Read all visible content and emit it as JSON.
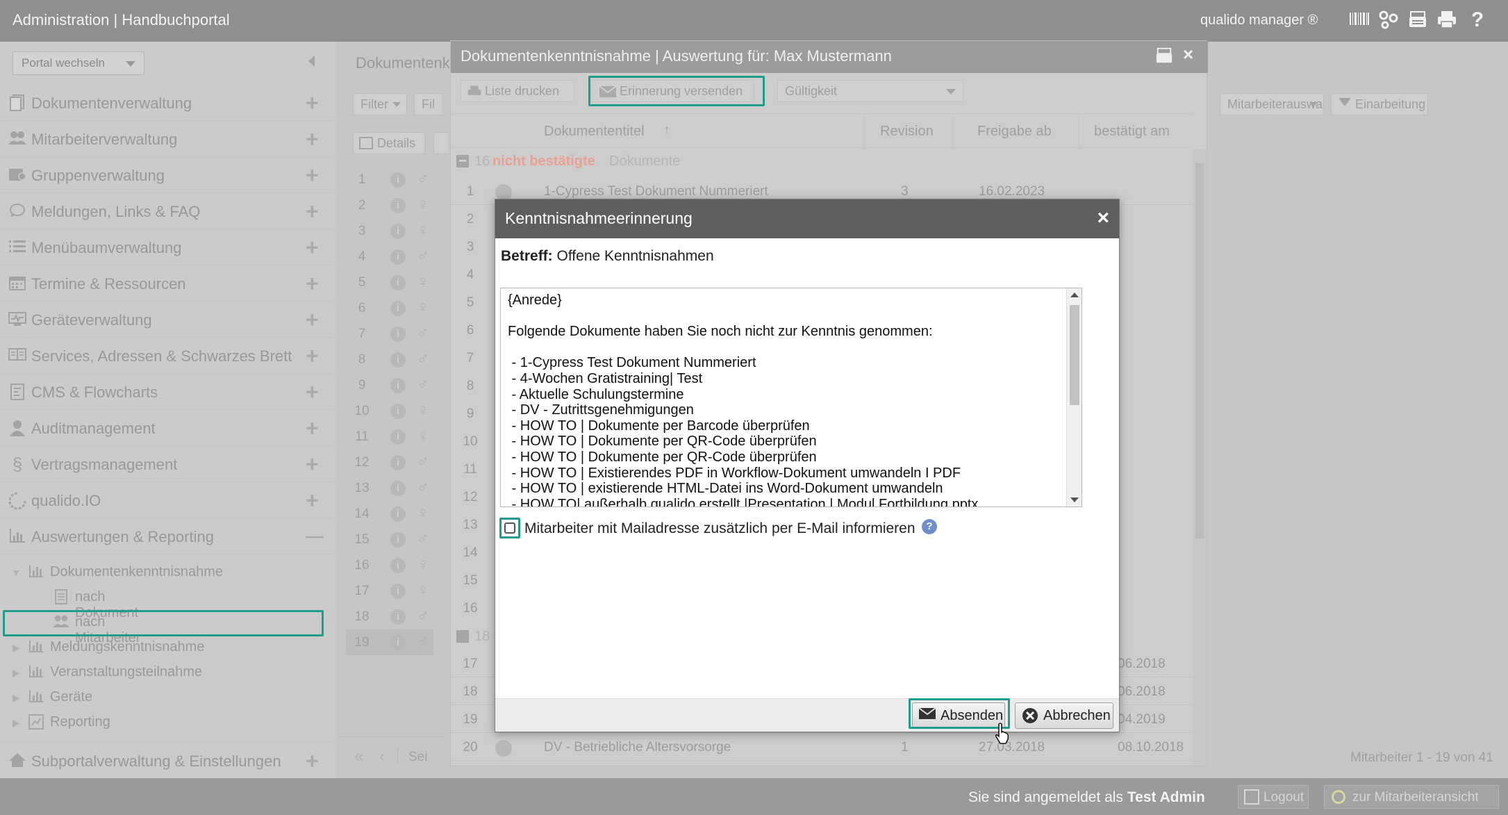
{
  "topbar": {
    "title": "Administration | Handbuchportal",
    "brand": "qualido manager ®",
    "icons": [
      "barcode-icon",
      "sitemap-icon",
      "fax-icon",
      "print-icon",
      "help-icon"
    ]
  },
  "sidebar": {
    "portal_select": "Portal wechseln",
    "items": [
      {
        "label": "Dokumentenverwaltung",
        "icon": "documents-icon"
      },
      {
        "label": "Mitarbeiterverwaltung",
        "icon": "users-icon"
      },
      {
        "label": "Gruppenverwaltung",
        "icon": "group-icon"
      },
      {
        "label": "Meldungen, Links & FAQ",
        "icon": "chat-icon"
      },
      {
        "label": "Menübaumverwaltung",
        "icon": "list-icon"
      },
      {
        "label": "Termine & Ressourcen",
        "icon": "calendar-icon"
      },
      {
        "label": "Geräteverwaltung",
        "icon": "device-icon"
      },
      {
        "label": "Services, Adressen & Schwarzes Brett",
        "icon": "address-book-icon"
      },
      {
        "label": "CMS & Flowcharts",
        "icon": "cms-icon"
      },
      {
        "label": "Auditmanagement",
        "icon": "auditor-icon"
      },
      {
        "label": "Vertragsmanagement",
        "icon": "paragraph-icon"
      },
      {
        "label": "qualido.IO",
        "icon": "io-icon"
      },
      {
        "label": "Auswertungen & Reporting",
        "icon": "chart-icon"
      }
    ],
    "subtree": {
      "parent": "Dokumentenkenntnisnahme",
      "children": [
        "nach Dokument",
        "nach Mitarbeiter"
      ],
      "siblings": [
        "Meldungskenntnisnahme",
        "Veranstaltungsteilnahme",
        "Geräte",
        "Reporting"
      ]
    },
    "footer_item": "Subportalverwaltung & Einstellungen"
  },
  "content": {
    "heading": "Dokumentenk",
    "filter_label": "Filter",
    "filter_cut": "Fil",
    "details_label": "Details",
    "mitarbeiter_select": "Mitarbeiterauswa",
    "einarbeitung_label": "Einarbeitung",
    "pager_label": "Sei",
    "count_label": "Mitarbeiter 1 - 19 von 41",
    "row_numbers": [
      "1",
      "2",
      "3",
      "4",
      "5",
      "6",
      "7",
      "8",
      "9",
      "10",
      "11",
      "12",
      "13",
      "14",
      "15",
      "16",
      "17",
      "18",
      "19"
    ]
  },
  "bgmodal": {
    "title": "Dokumentenkenntnisnahme | Auswertung für: Max Mustermann",
    "print_label": "Liste drucken",
    "reminder_label": "Erinnerung versenden",
    "validity_placeholder": "Gültigkeit",
    "columns": [
      "Dokumententitel",
      "Revision",
      "Freigabe ab",
      "bestätigt am"
    ],
    "group_count": "16",
    "group_label": "nicht bestätigte",
    "group_suffix": "Dokumente",
    "second_group_count": "18",
    "first_row": {
      "num": "1",
      "title": "1-Cypress Test Dokument Nummeriert",
      "revision": "3",
      "freigabe": "16.02.2023"
    },
    "left_numbers": [
      "2",
      "3",
      "4",
      "5",
      "6",
      "7",
      "8",
      "9",
      "10",
      "11",
      "12",
      "13",
      "14",
      "15",
      "16"
    ],
    "bottom_rows": [
      {
        "num": "17",
        "bestaetigt": "06.2018"
      },
      {
        "num": "18",
        "bestaetigt": "06.2018"
      },
      {
        "num": "19",
        "bestaetigt": "04.2019"
      },
      {
        "num": "20",
        "title": "DV - Betriebliche Altersvorsorge",
        "revision": "1",
        "freigabe": "27.03.2018",
        "bestaetigt": "08.10.2018"
      }
    ]
  },
  "dialog": {
    "title": "Kenntnisnahmeerinnerung",
    "subject_label": "Betreff:",
    "subject_value": "Offene Kenntnisnahmen",
    "message": "{Anrede}\n\nFolgende Dokumente haben Sie noch nicht zur Kenntnis genommen:\n\n - 1-Cypress Test Dokument Nummeriert\n - 4-Wochen Gratistraining| Test\n - Aktuelle Schulungstermine\n - DV - Zutrittsgenehmigungen\n - HOW TO | Dokumente per Barcode überprüfen\n - HOW TO | Dokumente per QR-Code überprüfen\n - HOW TO | Dokumente per QR-Code überprüfen\n - HOW TO | Existierendes PDF in Workflow-Dokument umwandeln I PDF\n - HOW TO | existierende HTML-Datei ins Word-Dokument umwandeln\n - HOW TO| außerhalb qualido erstellt |Presentation | Modul Fortbildung pptx",
    "checkbox_label": "Mitarbeiter mit Mailadresse zusätzlich per E-Mail informieren",
    "send_label": "Absenden",
    "cancel_label": "Abbrechen"
  },
  "bottombar": {
    "logged_in_prefix": "Sie sind angemeldet als",
    "user": "Test Admin",
    "logout_label": "Logout",
    "employee_view_label": "zur Mitarbeiteransicht"
  },
  "colors": {
    "highlight": "#1e9c8c",
    "dialog_header": "#5e5e5e",
    "group_label": "#e8a090"
  }
}
